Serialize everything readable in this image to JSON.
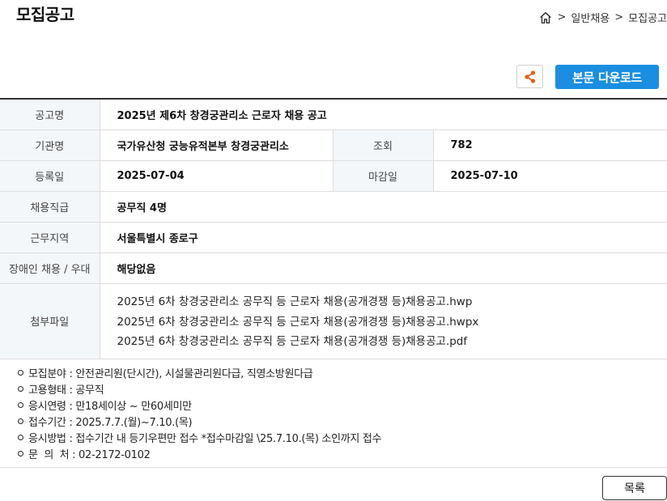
{
  "header": {
    "title": "모집공고",
    "breadcrumb": [
      ">",
      "일반채용",
      ">",
      "모집공고"
    ]
  },
  "actions": {
    "share_icon": "share-icon",
    "download_label": "본문 다운로드"
  },
  "info": {
    "labels": {
      "title": "공고명",
      "org": "기관명",
      "views": "조회",
      "registered": "등록일",
      "deadline": "마감일",
      "job_grade": "채용직급",
      "location": "근무지역",
      "disability": "장애인 채용 / 우대",
      "attachments": "첨부파일"
    },
    "values": {
      "title": "2025년 제6차 창경궁관리소 근로자 채용 공고",
      "org": "국가유산청 궁능유적본부 창경궁관리소",
      "views": "782",
      "registered": "2025-07-04",
      "deadline": "2025-07-10",
      "job_grade": "공무직 4명",
      "location": "서울특별시 종로구",
      "disability": "해당없음"
    },
    "attachments": [
      "2025년 6차 창경궁관리소 공무직 등 근로자 채용(공개경쟁 등)채용공고.hwp",
      "2025년 6차 창경궁관리소 공무직 등 근로자 채용(공개경쟁 등)채용공고.hwpx",
      "2025년 6차 창경궁관리소 공무직 등 근로자 채용(공개경쟁 등)채용공고.pdf"
    ]
  },
  "details": [
    "모집분야 : 안전관리원(단시간), 시설물관리원다급, 직영소방원다급",
    "고용형태 : 공무직",
    "응시연령 : 만18세이상 ~ 만60세미만",
    "접수기간 : 2025.7.7.(월)~7.10.(목)",
    "응시방법 : 접수기간 내 등기우편만 접수  *접수마감일 \\25.7.10.(목) 소인까지 접수",
    "문  의  처 : 02-2172-0102"
  ],
  "footer": {
    "list_label": "목록"
  }
}
